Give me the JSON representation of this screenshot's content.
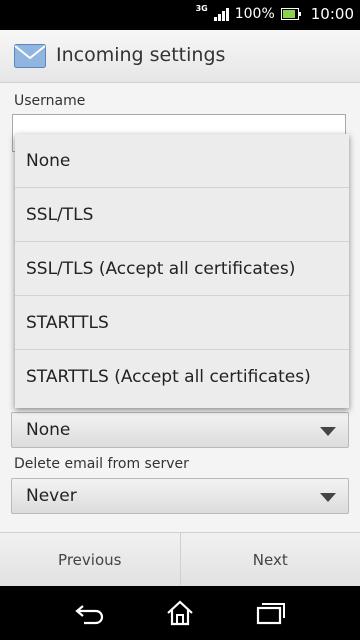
{
  "status_bar": {
    "network": "3G",
    "battery_percent": "100%",
    "battery_level": 1.0,
    "time": "10:00"
  },
  "action_bar": {
    "title": "Incoming settings",
    "icon": "mail-icon"
  },
  "form": {
    "username_label": "Username",
    "security_type_value": "None",
    "delete_email_label": "Delete email from server",
    "delete_email_value": "Never"
  },
  "dropdown": {
    "options": [
      "None",
      "SSL/TLS",
      "SSL/TLS (Accept all certificates)",
      "STARTTLS",
      "STARTTLS (Accept all certificates)"
    ]
  },
  "buttons": {
    "previous": "Previous",
    "next": "Next"
  },
  "nav": {
    "back": "back-icon",
    "home": "home-icon",
    "recents": "recents-icon"
  },
  "colors": {
    "battery_fill": "#8bd34b",
    "status_bar_bg": "#000000"
  }
}
